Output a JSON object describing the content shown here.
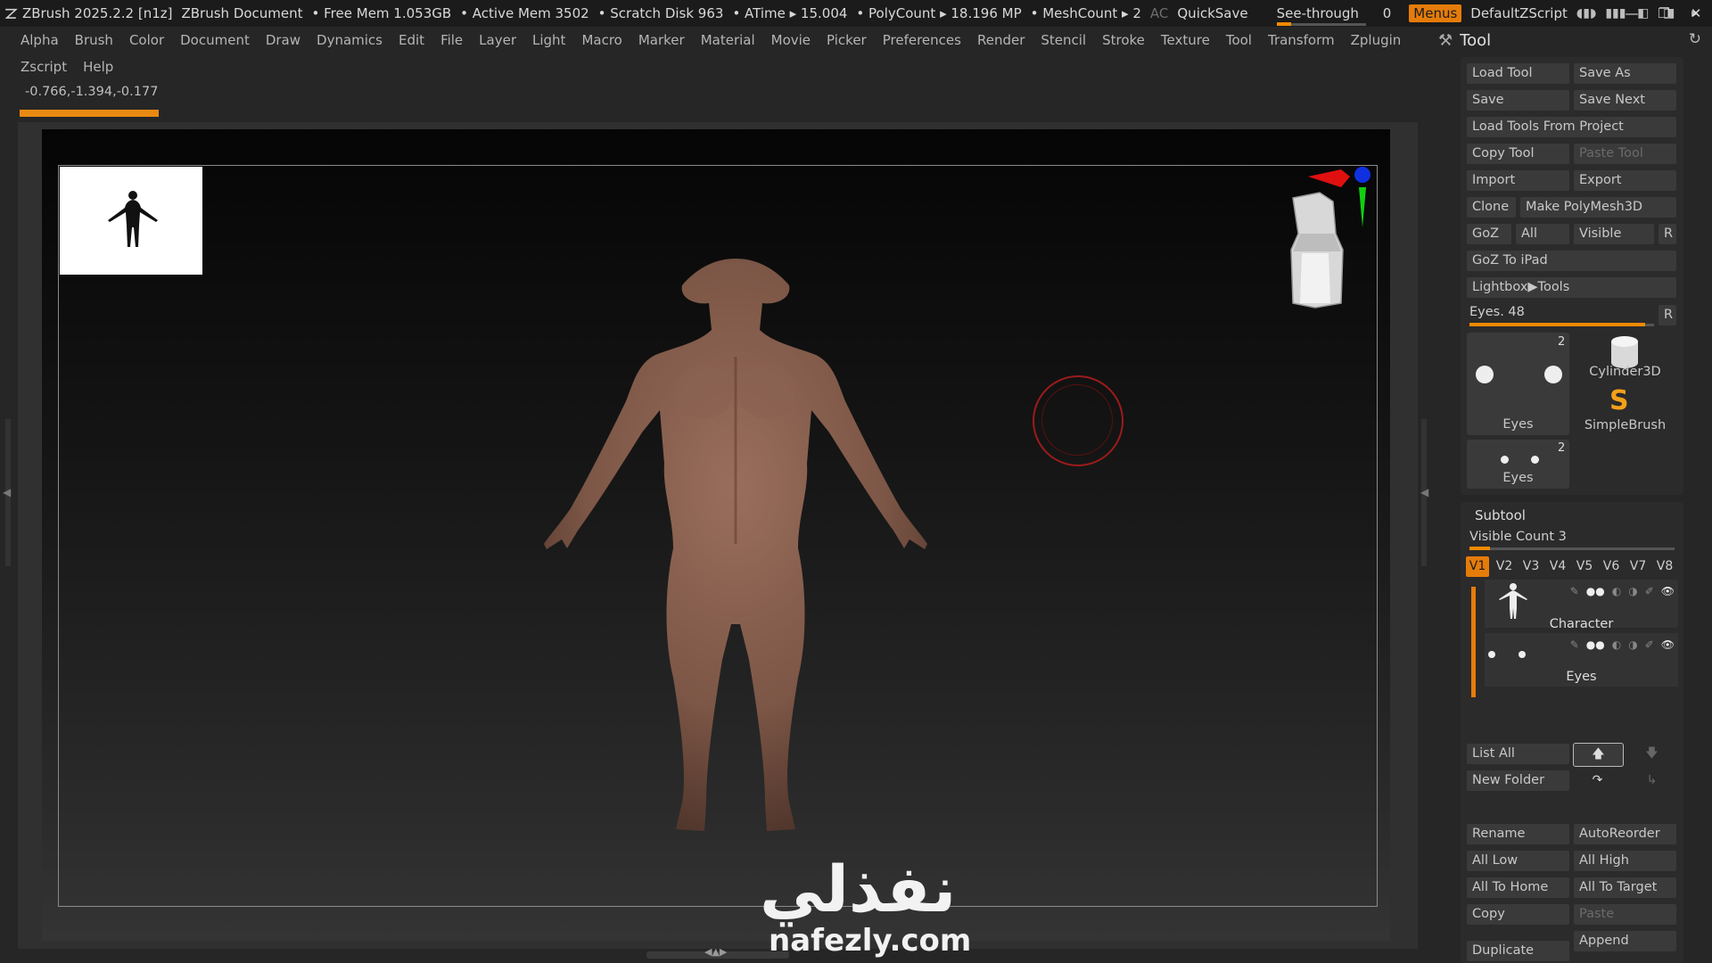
{
  "titlebar": {
    "app": "ZBrush 2025.2.2 [n1z]",
    "doc": "ZBrush Document",
    "free_mem": "• Free Mem 1.053GB",
    "active_mem": "• Active Mem 3502",
    "scratch": "• Scratch Disk 963",
    "atime": "• ATime ▸ 15.004",
    "polycount": "• PolyCount ▸ 18.196 MP",
    "meshcount": "• MeshCount ▸ 2",
    "ac": "AC",
    "quicksave": "QuickSave",
    "see_through_label": "See-through",
    "see_through_value": "0",
    "menus": "Menus",
    "zscript": "DefaultZScript"
  },
  "menus_row1": [
    "Alpha",
    "Brush",
    "Color",
    "Document",
    "Draw",
    "Dynamics",
    "Edit",
    "File",
    "Layer",
    "Light",
    "Macro",
    "Marker",
    "Material",
    "Movie",
    "Picker",
    "Preferences",
    "Render",
    "Stencil",
    "Stroke",
    "Texture",
    "Tool",
    "Transform",
    "Zplugin"
  ],
  "menus_row2": [
    "Zscript",
    "Help"
  ],
  "coords": "-0.766,-1.394,-0.177",
  "watermark": {
    "arabic": "نفذلي",
    "latin": "nafezly.com"
  },
  "tool_panel": {
    "title": "Tool",
    "buttons": {
      "load_tool": "Load Tool",
      "save_as": "Save As",
      "save": "Save",
      "save_next": "Save Next",
      "load_from_project": "Load Tools From Project",
      "copy_tool": "Copy Tool",
      "paste_tool": "Paste Tool",
      "import": "Import",
      "export": "Export",
      "clone": "Clone",
      "make_polymesh": "Make PolyMesh3D",
      "goz": "GoZ",
      "all": "All",
      "visible": "Visible",
      "r": "R",
      "goz_ipad": "GoZ To iPad",
      "lightbox": "Lightbox▶Tools"
    },
    "eyes_slider": {
      "label": "Eyes. 48",
      "fraction": 0.95,
      "r": "R"
    },
    "tiles": [
      {
        "label": "Eyes",
        "count": "2"
      },
      {
        "label": "Cylinder3D"
      },
      {
        "label": "SimpleBrush"
      },
      {
        "label": "Eyes",
        "count": "2"
      }
    ]
  },
  "subtool": {
    "title": "Subtool",
    "visible_count": "Visible Count 3",
    "visible_fraction": 0.1,
    "tabs": [
      "V1",
      "V2",
      "V3",
      "V4",
      "V5",
      "V6",
      "V7",
      "V8"
    ],
    "items": [
      {
        "name": "Character"
      },
      {
        "name": "Eyes"
      }
    ],
    "buttons": {
      "list_all": "List All",
      "new_folder": "New Folder",
      "rename": "Rename",
      "autoreorder": "AutoReorder",
      "all_low": "All Low",
      "all_high": "All High",
      "all_to_home": "All To Home",
      "all_to_target": "All To Target",
      "copy": "Copy",
      "paste": "Paste",
      "duplicate": "Duplicate",
      "append": "Append"
    }
  },
  "colors": {
    "accent": "#e57c0a",
    "skin": "#8a6150",
    "gizmo_x": "#e01010",
    "gizmo_y": "#10d010",
    "gizmo_z": "#1030e0"
  }
}
